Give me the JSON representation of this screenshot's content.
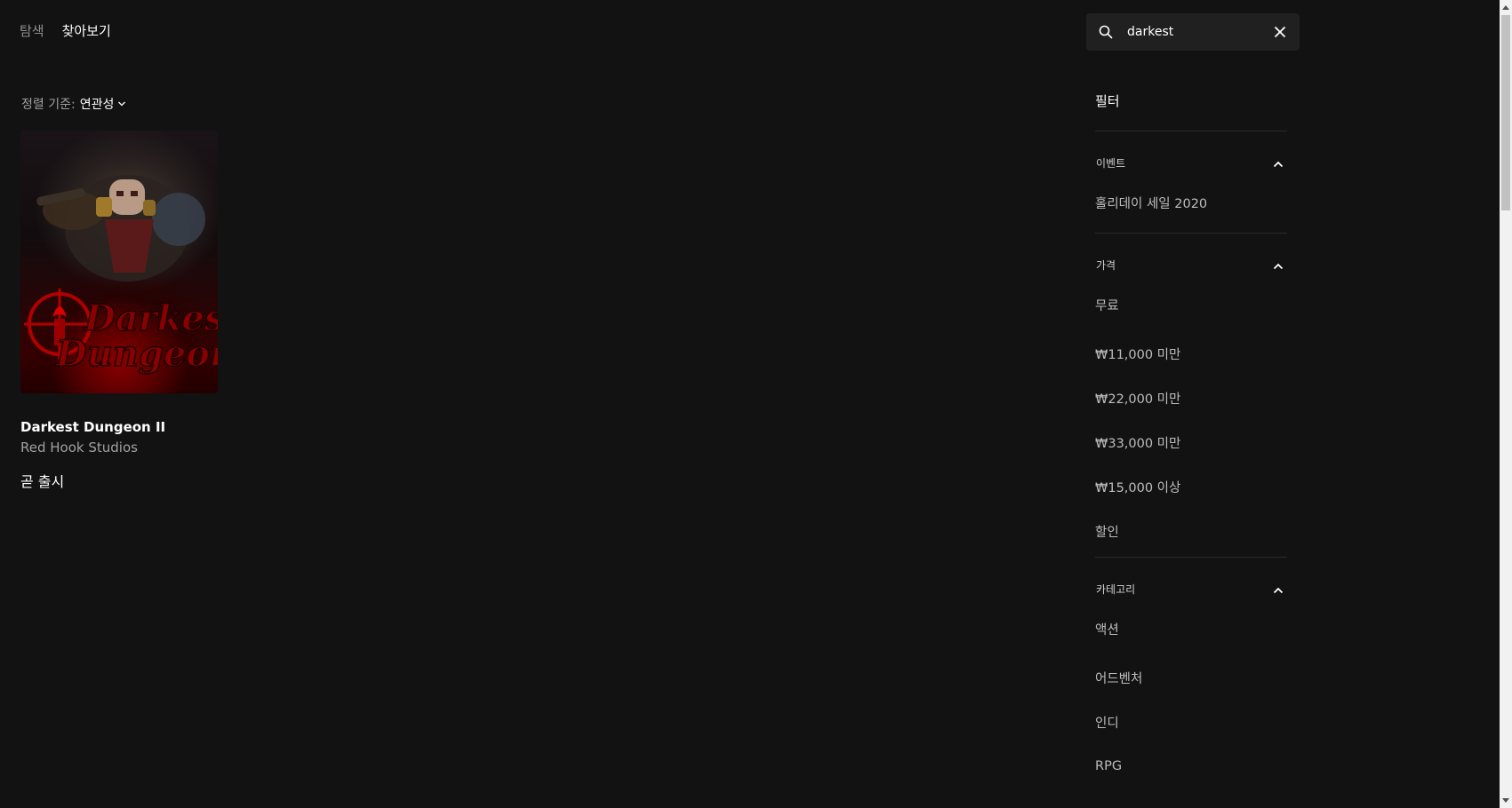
{
  "nav": {
    "tabs": [
      {
        "label": "탐색",
        "active": false
      },
      {
        "label": "찾아보기",
        "active": true
      }
    ]
  },
  "search": {
    "value": "darkest",
    "icon": "search-icon",
    "clear_icon": "close-icon"
  },
  "sort": {
    "label": "정렬 기준:",
    "value": "연관성"
  },
  "results": [
    {
      "title": "Darkest Dungeon II",
      "developer": "Red Hook Studios",
      "status": "곧 출시",
      "cover_logo_line1": "Darkest",
      "cover_logo_line2": "Dungeon"
    }
  ],
  "filters": {
    "heading": "필터",
    "groups": [
      {
        "name": "이벤트",
        "options": [
          "홀리데이 세일 2020"
        ]
      },
      {
        "name": "가격",
        "options": [
          "무료",
          "₩11,000 미만",
          "₩22,000 미만",
          "₩33,000 미만",
          "₩15,000 이상",
          "할인"
        ]
      },
      {
        "name": "카테고리",
        "options": [
          "액션",
          "어드벤처",
          "인디",
          "RPG"
        ]
      }
    ]
  },
  "colors": {
    "background": "#121212",
    "panel": "#202020",
    "text_primary": "#ffffff",
    "text_secondary": "#a0a0a0"
  }
}
